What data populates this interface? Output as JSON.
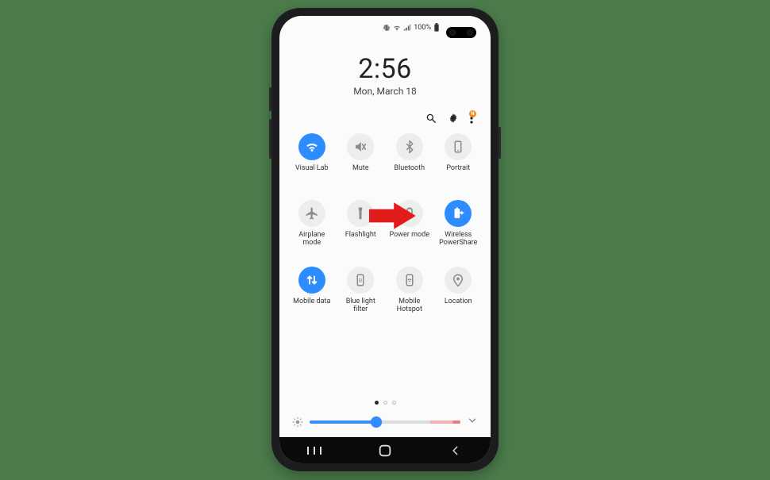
{
  "status": {
    "battery_pct": "100%"
  },
  "clock": {
    "time": "2:56",
    "date": "Mon, March 18"
  },
  "menu_badge": "N",
  "tiles": [
    {
      "id": "wifi",
      "label": "Visual Lab",
      "active": true
    },
    {
      "id": "mute",
      "label": "Mute",
      "active": false
    },
    {
      "id": "bluetooth",
      "label": "Bluetooth",
      "active": false
    },
    {
      "id": "portrait",
      "label": "Portrait",
      "active": false
    },
    {
      "id": "airplane",
      "label": "Airplane mode",
      "active": false
    },
    {
      "id": "flashlight",
      "label": "Flashlight",
      "active": false
    },
    {
      "id": "power-mode",
      "label": "Power mode",
      "active": false
    },
    {
      "id": "powershare",
      "label": "Wireless PowerShare",
      "active": true
    },
    {
      "id": "mobile-data",
      "label": "Mobile data",
      "active": true
    },
    {
      "id": "blue-light",
      "label": "Blue light filter",
      "active": false
    },
    {
      "id": "hotspot",
      "label": "Mobile Hotspot",
      "active": false
    },
    {
      "id": "location",
      "label": "Location",
      "active": false
    }
  ],
  "pages": {
    "count": 3,
    "active": 0
  },
  "brightness": {
    "percent": 44
  },
  "arrow": {
    "target": "powershare"
  },
  "colors": {
    "accent": "#2d8cff",
    "arrow": "#e21b1b",
    "badge": "#f28c13"
  }
}
